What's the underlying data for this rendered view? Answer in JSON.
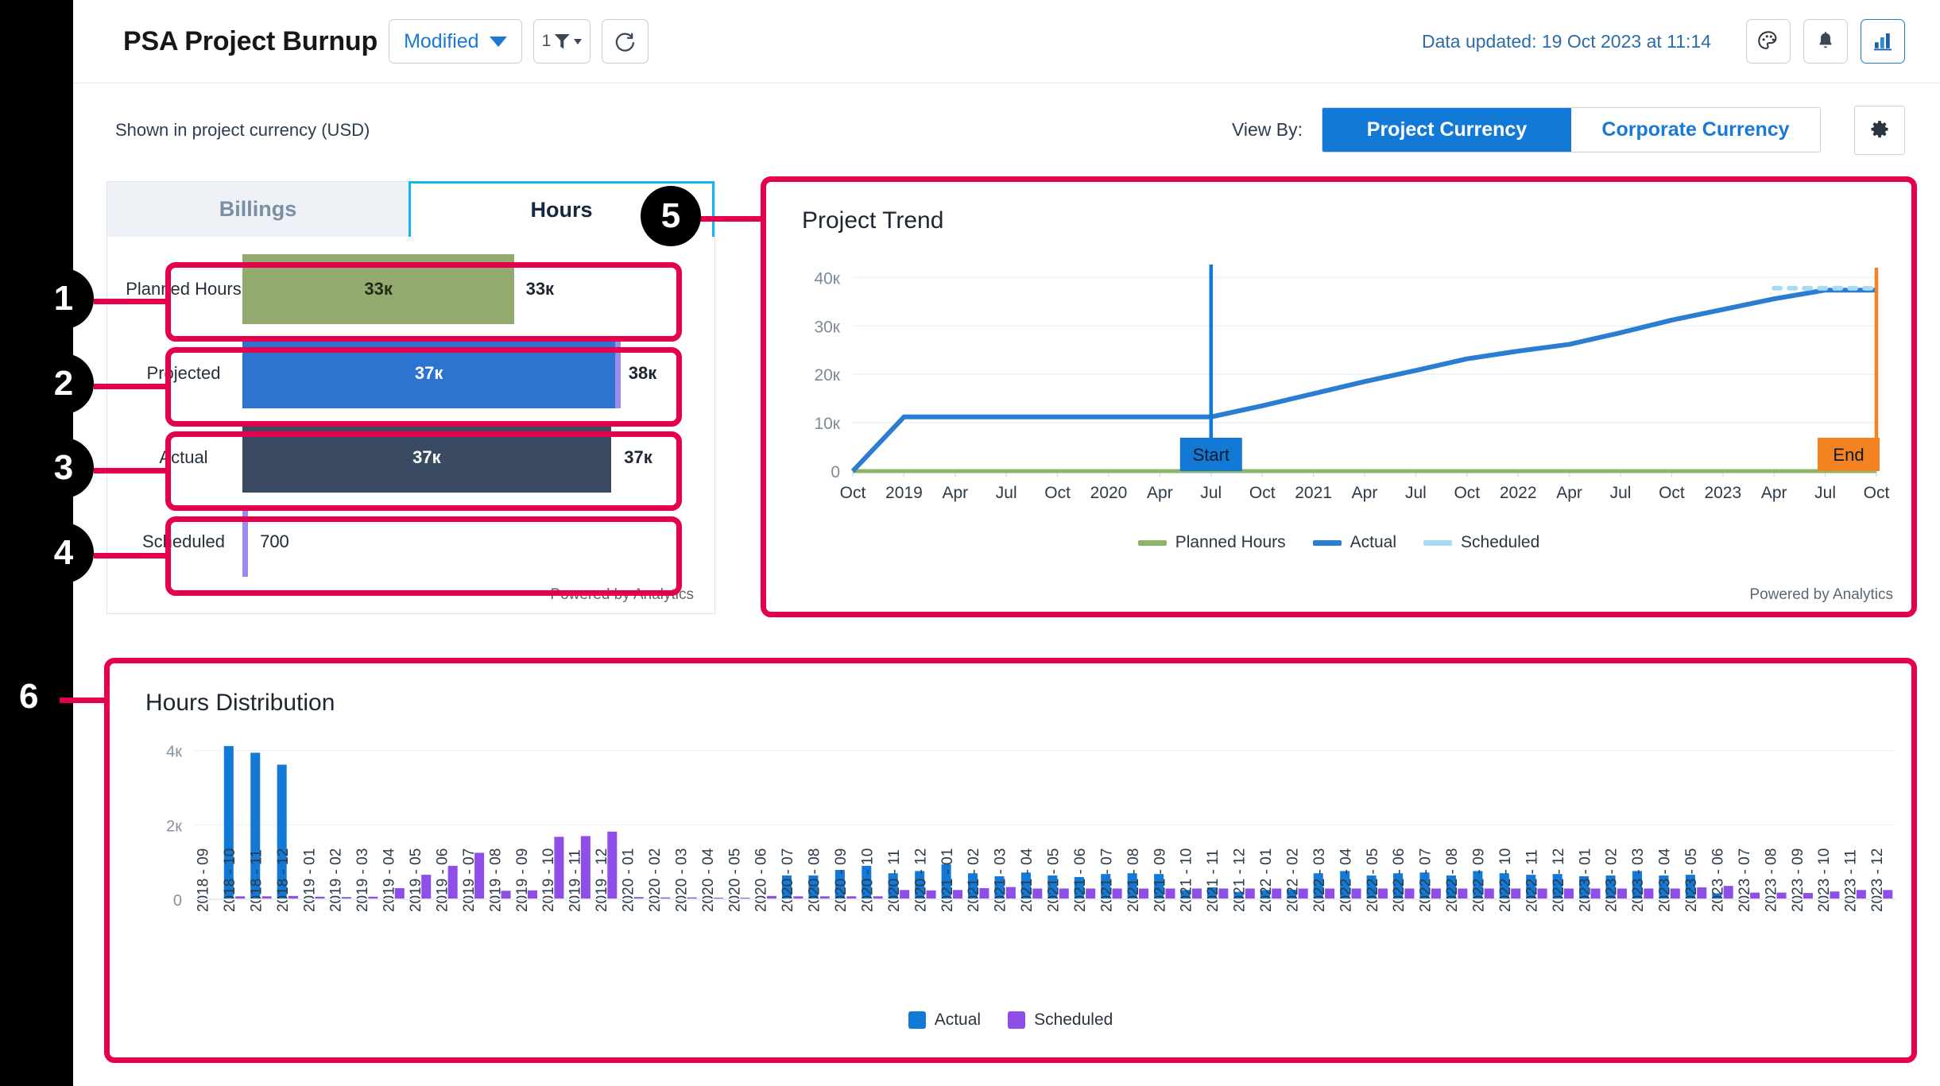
{
  "header": {
    "app_title": "PSA Project Burnup",
    "modified_label": "Modified",
    "filter_count": "1",
    "refresh_icon": "refresh-icon",
    "updated_text": "Data updated: 19 Oct 2023 at 11:14",
    "palette_icon": "palette-icon",
    "bell_icon": "bell-icon",
    "chart_icon": "bar-chart-icon"
  },
  "subbar": {
    "currency_note": "Shown in project currency (USD)",
    "view_by_label": "View By:",
    "segments": [
      {
        "label": "Project Currency",
        "selected": true
      },
      {
        "label": "Corporate Currency",
        "selected": false
      }
    ],
    "settings_icon": "gear-icon"
  },
  "left_panel": {
    "tabs": [
      {
        "label": "Billings",
        "active": false
      },
      {
        "label": "Hours",
        "active": true
      }
    ],
    "bars": [
      {
        "label": "Planned Hours",
        "value_label": "33к",
        "end_label": "33к",
        "type": "planned"
      },
      {
        "label": "Projected",
        "value_label": "37к",
        "end_label": "38к",
        "type": "projected"
      },
      {
        "label": "Actual",
        "value_label": "37к",
        "end_label": "37к",
        "type": "actual"
      },
      {
        "label": "Scheduled",
        "value_label": "",
        "end_label": "700",
        "type": "scheduled"
      }
    ],
    "footer": "Powered by Analytics"
  },
  "trend_panel": {
    "title": "Project Trend",
    "start_label": "Start",
    "end_label": "End",
    "footer": "Powered by Analytics"
  },
  "dist_panel": {
    "title": "Hours Distribution"
  },
  "callouts": [
    {
      "id": "1",
      "number": "1"
    },
    {
      "id": "2",
      "number": "2"
    },
    {
      "id": "3",
      "number": "3"
    },
    {
      "id": "4",
      "number": "4"
    },
    {
      "id": "5",
      "number": "5"
    },
    {
      "id": "6",
      "number": "6"
    }
  ],
  "colors": {
    "accent_blue": "#1279d6",
    "highlight_crimson": "#e4004c",
    "planned_green": "#93ab6e",
    "projected_blue": "#2c74cf",
    "actual_navy": "#3b4a63",
    "scheduled_purple": "#9b8af0",
    "line_actual": "#2b7cd3",
    "line_planned": "#8cb46a",
    "line_scheduled": "#a9dbf0",
    "bar_actual": "#1279d6",
    "bar_scheduled": "#8f4ee8",
    "end_orange": "#f58220"
  },
  "chart_data": [
    {
      "type": "line",
      "title": "Project Trend",
      "xlabel": "",
      "ylabel": "",
      "ylim": [
        0,
        44000
      ],
      "yticks": [
        0,
        10000,
        20000,
        30000,
        40000
      ],
      "ytick_labels": [
        "0",
        "10к",
        "20к",
        "30к",
        "40к"
      ],
      "grid": true,
      "legend_position": "bottom",
      "xtick_labels": [
        "Oct",
        "2019",
        "Apr",
        "Jul",
        "Oct",
        "2020",
        "Apr",
        "Jul",
        "Oct",
        "2021",
        "Apr",
        "Jul",
        "Oct",
        "2022",
        "Apr",
        "Jul",
        "Oct",
        "2023",
        "Apr",
        "Jul",
        "Oct"
      ],
      "annotations": [
        {
          "label": "Start",
          "x_index": 7,
          "color": "#1279d6"
        },
        {
          "label": "End",
          "x_index": 20,
          "color": "#f58220"
        }
      ],
      "series": [
        {
          "name": "Planned Hours",
          "color": "#8cb46a",
          "values": [
            0,
            0,
            0,
            0,
            0,
            0,
            0,
            0,
            0,
            0,
            0,
            0,
            0,
            0,
            0,
            0,
            0,
            0,
            0,
            0,
            0
          ]
        },
        {
          "name": "Actual",
          "color": "#2b7cd3",
          "values": [
            0,
            11200,
            11200,
            11200,
            11200,
            11200,
            11200,
            11200,
            13500,
            16000,
            18500,
            20800,
            23200,
            24800,
            26200,
            28600,
            31200,
            33400,
            35600,
            37400,
            37400
          ]
        },
        {
          "name": "Scheduled",
          "color": "#a9dbf0",
          "dashed": true,
          "values": [
            null,
            null,
            null,
            null,
            null,
            null,
            null,
            null,
            null,
            null,
            null,
            null,
            null,
            null,
            null,
            null,
            null,
            null,
            37800,
            37800,
            37800
          ]
        }
      ]
    },
    {
      "type": "bar",
      "title": "Hours Distribution",
      "xlabel": "",
      "ylabel": "",
      "ylim": [
        0,
        4400
      ],
      "yticks": [
        0,
        2000,
        4000
      ],
      "ytick_labels": [
        "0",
        "2к",
        "4к"
      ],
      "grid": true,
      "legend_position": "bottom",
      "categories": [
        "2018 - 09",
        "2018 - 10",
        "2018 - 11",
        "2018 - 12",
        "2019 - 01",
        "2019 - 02",
        "2019 - 03",
        "2019 - 04",
        "2019 - 05",
        "2019 - 06",
        "2019 - 07",
        "2019 - 08",
        "2019 - 09",
        "2019 - 10",
        "2019 - 11",
        "2019 - 12",
        "2020 - 01",
        "2020 - 02",
        "2020 - 03",
        "2020 - 04",
        "2020 - 05",
        "2020 - 06",
        "2020 - 07",
        "2020 - 08",
        "2020 - 09",
        "2020 - 10",
        "2020 - 11",
        "2020 - 12",
        "2021 - 01",
        "2021 - 02",
        "2021 - 03",
        "2021 - 04",
        "2021 - 05",
        "2021 - 06",
        "2021 - 07",
        "2021 - 08",
        "2021 - 09",
        "2021 - 10",
        "2021 - 11",
        "2021 - 12",
        "2022 - 01",
        "2022 - 02",
        "2022 - 03",
        "2022 - 04",
        "2022 - 05",
        "2022 - 06",
        "2022 - 07",
        "2022 - 08",
        "2022 - 09",
        "2022 - 10",
        "2022 - 11",
        "2022 - 12",
        "2023 - 01",
        "2023 - 02",
        "2023 - 03",
        "2023 - 04",
        "2023 - 05",
        "2023 - 06",
        "2023 - 07",
        "2023 - 08",
        "2023 - 09",
        "2023 - 10",
        "2023 - 11",
        "2023 - 12"
      ],
      "series": [
        {
          "name": "Actual",
          "color": "#1279d6",
          "values": [
            0,
            4120,
            3940,
            3620,
            0,
            0,
            0,
            0,
            0,
            0,
            0,
            0,
            0,
            0,
            0,
            0,
            0,
            0,
            0,
            0,
            0,
            0,
            640,
            640,
            790,
            900,
            700,
            760,
            940,
            700,
            620,
            720,
            640,
            600,
            680,
            700,
            680,
            250,
            320,
            200,
            250,
            260,
            700,
            760,
            640,
            700,
            720,
            640,
            760,
            700,
            660,
            680,
            620,
            640,
            760,
            640,
            660,
            160,
            0,
            0,
            0,
            0,
            0,
            0
          ]
        },
        {
          "name": "Scheduled",
          "color": "#8f4ee8",
          "values": [
            0,
            80,
            80,
            90,
            70,
            60,
            70,
            300,
            660,
            900,
            1250,
            230,
            240,
            1680,
            1700,
            1820,
            60,
            50,
            50,
            40,
            40,
            90,
            80,
            80,
            80,
            80,
            250,
            240,
            250,
            300,
            330,
            290,
            290,
            290,
            290,
            290,
            290,
            290,
            290,
            290,
            290,
            290,
            290,
            290,
            290,
            290,
            290,
            290,
            290,
            290,
            290,
            290,
            290,
            290,
            290,
            290,
            320,
            360,
            180,
            180,
            170,
            210,
            250,
            250
          ]
        }
      ]
    }
  ]
}
